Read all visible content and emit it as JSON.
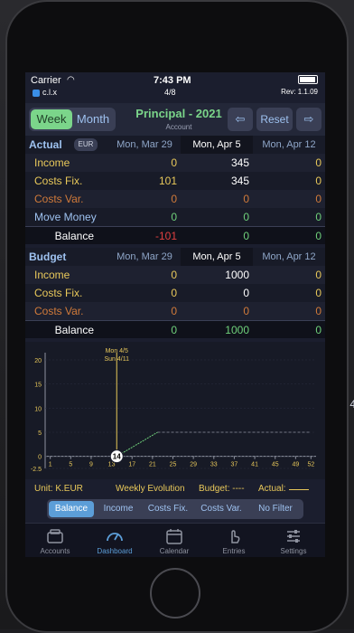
{
  "status": {
    "carrier": "Carrier",
    "time": "7:43 PM",
    "page": "4/8",
    "app": "c.l.x",
    "rev": "Rev: 1.1.09"
  },
  "topnav": {
    "week": "Week",
    "month": "Month",
    "title": "Principal - 2021",
    "subtitle": "Account",
    "prev": "⇦",
    "reset": "Reset",
    "next": "⇨"
  },
  "actual": {
    "label": "Actual",
    "currency": "EUR",
    "dates": [
      "Mon, Mar 29",
      "Mon, Apr 5",
      "Mon, Apr 12"
    ],
    "rows": [
      {
        "label": "Income",
        "values": [
          "0",
          "345",
          "0"
        ]
      },
      {
        "label": "Costs Fix.",
        "values": [
          "101",
          "345",
          "0"
        ]
      },
      {
        "label": "Costs Var.",
        "values": [
          "0",
          "0",
          "0"
        ]
      },
      {
        "label": "Move Money",
        "values": [
          "0",
          "0",
          "0"
        ]
      }
    ],
    "balance": {
      "label": "Balance",
      "values": [
        "-101",
        "0",
        "0"
      ]
    }
  },
  "budget": {
    "label": "Budget",
    "dates": [
      "Mon, Mar 29",
      "Mon, Apr 5",
      "Mon, Apr 12"
    ],
    "rows": [
      {
        "label": "Income",
        "values": [
          "0",
          "1000",
          "0"
        ]
      },
      {
        "label": "Costs Fix.",
        "values": [
          "0",
          "0",
          "0"
        ]
      },
      {
        "label": "Costs Var.",
        "values": [
          "0",
          "0",
          "0"
        ]
      }
    ],
    "balance": {
      "label": "Balance",
      "values": [
        "0",
        "1000",
        "0"
      ]
    }
  },
  "chart": {
    "marker_label_1": "Mon 4/5",
    "marker_label_2": "Sun 4/11",
    "current_week": "14"
  },
  "chart_data": {
    "type": "line",
    "x": [
      1,
      5,
      9,
      13,
      17,
      21,
      25,
      29,
      33,
      37,
      41,
      45,
      49,
      52
    ],
    "x_ticks": [
      "1",
      "5",
      "9",
      "13",
      "17",
      "21",
      "25",
      "29",
      "33",
      "37",
      "41",
      "45",
      "49",
      "52"
    ],
    "y_ticks": [
      "20",
      "15",
      "10",
      "5",
      "0",
      "-2.5"
    ],
    "ylim": [
      -2.5,
      20
    ],
    "series": [
      {
        "name": "Actual",
        "x": [
          14,
          22
        ],
        "y": [
          0,
          5
        ]
      },
      {
        "name": "Budget",
        "x": [
          22,
          52
        ],
        "y": [
          5,
          5
        ]
      }
    ],
    "marker_week": 14,
    "grid": true
  },
  "legend": {
    "unit": "Unit: K.EUR",
    "evolution": "Weekly Evolution",
    "budget": "Budget: ----",
    "actual": "Actual:"
  },
  "filters": [
    "Balance",
    "Income",
    "Costs Fix.",
    "Costs Var.",
    "No Filter"
  ],
  "tabs": [
    "Accounts",
    "Dashboard",
    "Calendar",
    "Entries",
    "Settings"
  ],
  "colors": {
    "accent_green": "#7bd58a",
    "accent_blue": "#5c9ed8",
    "yellow": "#e8c85a",
    "orange": "#d07a3a",
    "red": "#e04040"
  }
}
